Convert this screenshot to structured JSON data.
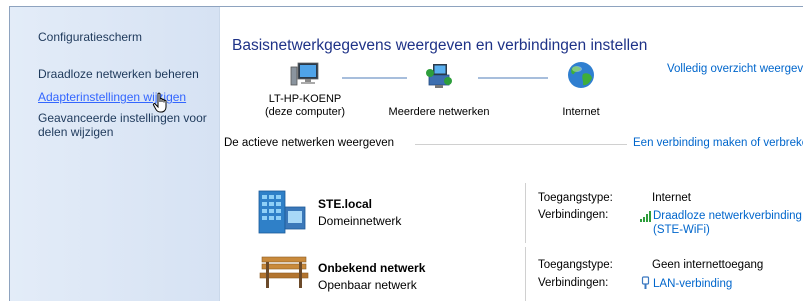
{
  "sidebar": {
    "title": "Configuratiescherm",
    "items": [
      {
        "label": "Draadloze netwerken beheren"
      },
      {
        "label": "Adapterinstellingen wijzigen"
      },
      {
        "label": "Geavanceerde instellingen voor"
      },
      {
        "label": "delen wijzigen"
      }
    ]
  },
  "main": {
    "heading": "Basisnetwerkgegevens weergeven en verbindingen instellen",
    "full_map_link": "Volledig overzicht weergeven",
    "nodes": [
      {
        "line1": "LT-HP-KOENP",
        "line2": "(deze computer)",
        "icon": "computer-icon"
      },
      {
        "line1": "Meerdere netwerken",
        "icon": "networks-icon"
      },
      {
        "line1": "Internet",
        "icon": "globe-icon"
      }
    ],
    "active_title": "De actieve netwerken weergeven",
    "connect_link": "Een verbinding maken of verbreken",
    "networks": [
      {
        "name": "STE.local",
        "type": "Domeinnetwerk",
        "icon": "domain-network-icon",
        "access_label": "Toegangstype:",
        "access_value": "Internet",
        "conn_label": "Verbindingen:",
        "conn_icon": "wireless-signal-icon",
        "conn_line1": "Draadloze netwerkverbinding",
        "conn_line2": "(STE-WiFi)"
      },
      {
        "name": "Onbekend netwerk",
        "type": "Openbaar netwerk",
        "icon": "park-bench-icon",
        "access_label": "Toegangstype:",
        "access_value": "Geen internettoegang",
        "conn_label": "Verbindingen:",
        "conn_icon": "lan-plug-icon",
        "conn_line1": "LAN-verbinding"
      }
    ]
  },
  "colors": {
    "heading": "#1e3287",
    "link": "#0066cc",
    "sidebar_text": "#1e395b",
    "sidebar_bg": "#d6e2f3"
  }
}
